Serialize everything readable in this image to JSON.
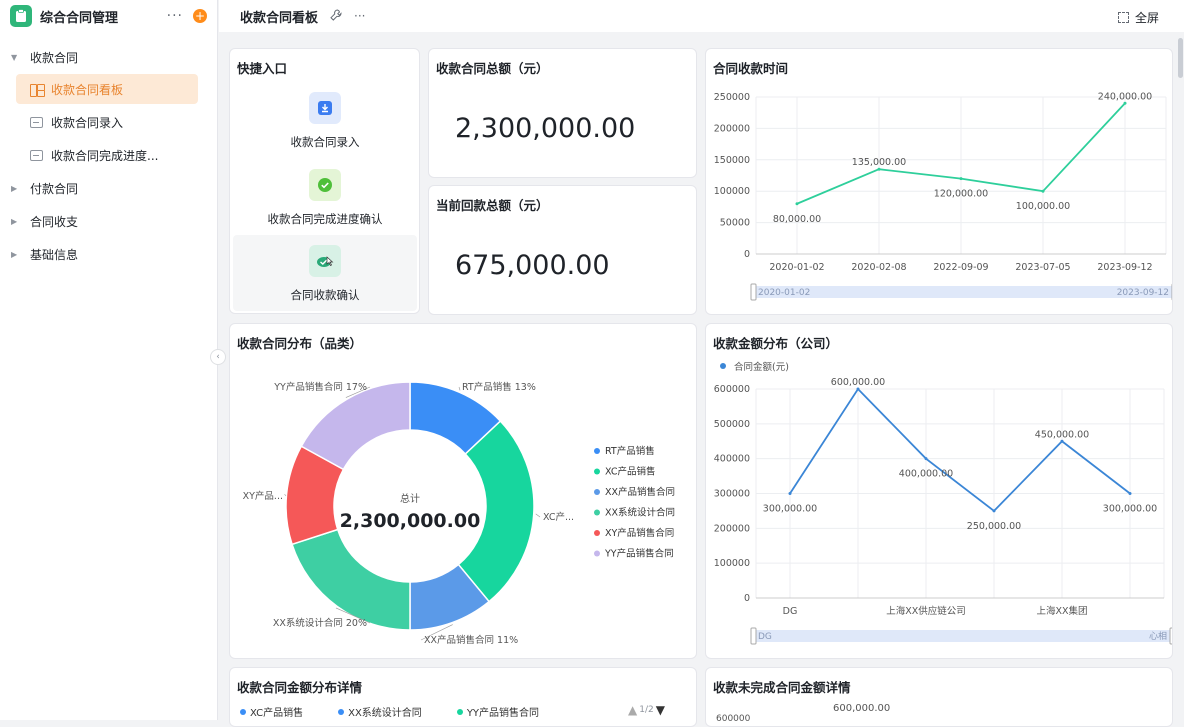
{
  "app": {
    "title": "综合合同管理",
    "more": "···",
    "add": "+"
  },
  "sidebar": {
    "groups": [
      {
        "label": "收款合同",
        "expanded": true
      },
      {
        "label": "付款合同",
        "expanded": false
      },
      {
        "label": "合同收支",
        "expanded": false
      },
      {
        "label": "基础信息",
        "expanded": false
      }
    ],
    "items": [
      {
        "label": "收款合同看板",
        "active": true
      },
      {
        "label": "收款合同录入",
        "active": false
      },
      {
        "label": "收款合同完成进度..."
      }
    ]
  },
  "topbar": {
    "title": "收款合同看板",
    "more": "···",
    "fullscreen": "全屏"
  },
  "quick_entry": {
    "title": "快捷入口",
    "items": [
      {
        "label": "收款合同录入",
        "icon": "download-icon"
      },
      {
        "label": "收款合同完成进度确认",
        "icon": "check-circle-icon"
      },
      {
        "label": "合同收款确认",
        "icon": "confirm-icon"
      }
    ]
  },
  "kpi": {
    "total_title": "收款合同总额（元）",
    "total_value": "2,300,000.00",
    "received_title": "当前回款总额（元）",
    "received_value": "675,000.00"
  },
  "colors": {
    "accent": "#e8842f",
    "line_green": "#2ecf9b",
    "line_blue": "#3b86d6"
  },
  "chart_data": [
    {
      "id": "time",
      "type": "line",
      "title": "合同收款时间",
      "categories": [
        "2020-01-02",
        "2020-02-08",
        "2022-09-09",
        "2023-07-05",
        "2023-09-12"
      ],
      "series": [
        {
          "values": [
            80000,
            135000,
            120000,
            100000,
            240000
          ],
          "labels": [
            "80,000.00",
            "135,000.00",
            "120,000.00",
            "100,000.00",
            "240,000.00"
          ]
        }
      ],
      "ylim": [
        0,
        250000
      ],
      "yticks": [
        "0",
        "50000",
        "100000",
        "150000",
        "200000",
        "250000"
      ],
      "zoom": {
        "start": "2020-01-02",
        "end": "2023-09-12"
      },
      "grid": true
    },
    {
      "id": "category",
      "type": "pie",
      "title": "收款合同分布（品类）",
      "center_label": "总计",
      "center_value": "2,300,000.00",
      "slices": [
        {
          "name": "RT产品销售",
          "value": 13,
          "label": "RT产品销售 13%",
          "color": "#3a8ef6"
        },
        {
          "name": "XC产品销售",
          "value": 26,
          "label": "XC产...",
          "color": "#17d69e"
        },
        {
          "name": "XX产品销售合同",
          "value": 11,
          "label": "XX产品销售合同 11%",
          "color": "#5b9ae8"
        },
        {
          "name": "XX系统设计合同",
          "value": 20,
          "label": "XX系统设计合同 20%",
          "color": "#3ecfa3"
        },
        {
          "name": "XY产品销售合同",
          "value": 13,
          "label": "XY产品...",
          "color": "#f55858"
        },
        {
          "name": "YY产品销售合同",
          "value": 17,
          "label": "YY产品销售合同 17%",
          "color": "#c5b7ec"
        }
      ],
      "legend": "right"
    },
    {
      "id": "company",
      "type": "line",
      "title": "收款金额分布（公司）",
      "legend_label": "合同金额(元)",
      "categories": [
        "DG",
        "",
        "上海XX供应链公司",
        "",
        "上海XX集团",
        ""
      ],
      "series": [
        {
          "name": "合同金额(元)",
          "values": [
            300000,
            600000,
            400000,
            250000,
            450000,
            300000
          ],
          "labels": [
            "300,000.00",
            "600,000.00",
            "400,000.00",
            "250,000.00",
            "450,000.00",
            "300,000.00"
          ]
        }
      ],
      "ylim": [
        0,
        600000
      ],
      "yticks": [
        "0",
        "100000",
        "200000",
        "300000",
        "400000",
        "500000",
        "600000"
      ],
      "zoom": {
        "start": "DG",
        "end": "心相"
      },
      "grid": true
    }
  ],
  "detail": {
    "title": "收款合同金额分布详情",
    "legend": [
      {
        "name": "XC产品销售",
        "color": "#3a8ef6"
      },
      {
        "name": "XX系统设计合同",
        "color": "#3a8ef6"
      },
      {
        "name": "YY产品销售合同",
        "color": "#17d69e"
      }
    ],
    "pager": "1/2"
  },
  "unfinished": {
    "title": "收款未完成合同金额详情",
    "ytick_top": "600000",
    "top_label": "600,000.00"
  }
}
